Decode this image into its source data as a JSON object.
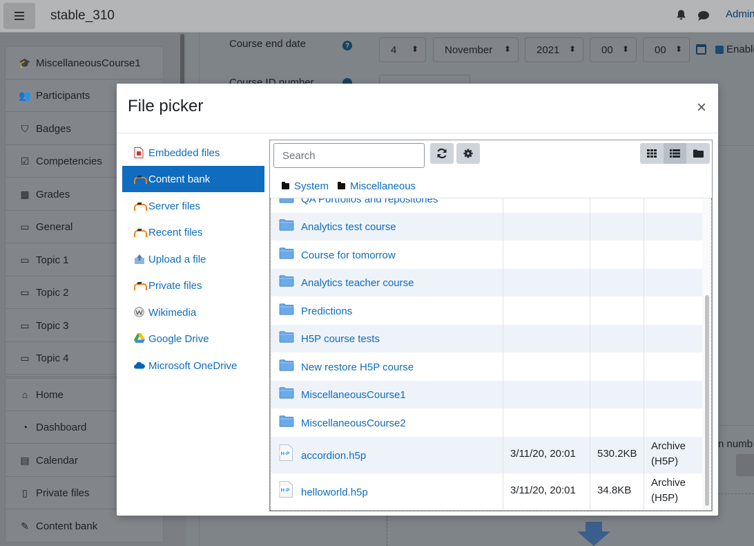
{
  "navbar": {
    "site_name": "stable_310",
    "user": "Admin"
  },
  "drawer": {
    "course_items": [
      {
        "label": "MiscellaneousCourse1",
        "icon": "graduation-cap-icon"
      },
      {
        "label": "Participants",
        "icon": "users-icon"
      },
      {
        "label": "Badges",
        "icon": "shield-icon"
      },
      {
        "label": "Competencies",
        "icon": "check-square-icon"
      },
      {
        "label": "Grades",
        "icon": "table-icon"
      },
      {
        "label": "General",
        "icon": "folder-icon"
      },
      {
        "label": "Topic 1",
        "icon": "folder-icon"
      },
      {
        "label": "Topic 2",
        "icon": "folder-icon"
      },
      {
        "label": "Topic 3",
        "icon": "folder-icon"
      },
      {
        "label": "Topic 4",
        "icon": "folder-icon"
      }
    ],
    "site_items": [
      {
        "label": "Home",
        "icon": "home-icon"
      },
      {
        "label": "Dashboard",
        "icon": "dashboard-icon"
      },
      {
        "label": "Calendar",
        "icon": "calendar-icon"
      },
      {
        "label": "Private files",
        "icon": "file-icon"
      },
      {
        "label": "Content bank",
        "icon": "paintbrush-icon"
      }
    ]
  },
  "form": {
    "course_end_date_label": "Course end date",
    "day": "4",
    "month": "November",
    "year": "2021",
    "hour": "00",
    "minute": "00",
    "enable_label": "Enable",
    "course_id_label": "Course ID number",
    "right_partial_label": "n numb"
  },
  "modal": {
    "title": "File picker",
    "close": "×",
    "repositories": [
      {
        "label": "Embedded files",
        "icon": "embedded-files-icon"
      },
      {
        "label": "Content bank",
        "icon": "moodle-icon",
        "active": true
      },
      {
        "label": "Server files",
        "icon": "moodle-icon"
      },
      {
        "label": "Recent files",
        "icon": "moodle-icon"
      },
      {
        "label": "Upload a file",
        "icon": "upload-icon"
      },
      {
        "label": "Private files",
        "icon": "moodle-icon"
      },
      {
        "label": "Wikimedia",
        "icon": "wikimedia-icon"
      },
      {
        "label": "Google Drive",
        "icon": "google-drive-icon"
      },
      {
        "label": "Microsoft OneDrive",
        "icon": "onedrive-icon"
      }
    ],
    "search_placeholder": "Search",
    "path": [
      "System",
      "Miscellaneous"
    ],
    "files": [
      {
        "name": "QA Portfolios and repositories",
        "type": "folder"
      },
      {
        "name": "Analytics test course",
        "type": "folder"
      },
      {
        "name": "Course for tomorrow",
        "type": "folder"
      },
      {
        "name": "Analytics teacher course",
        "type": "folder"
      },
      {
        "name": "Predictions",
        "type": "folder"
      },
      {
        "name": "H5P course tests",
        "type": "folder"
      },
      {
        "name": "New restore H5P course",
        "type": "folder"
      },
      {
        "name": "MiscellaneousCourse1",
        "type": "folder"
      },
      {
        "name": "MiscellaneousCourse2",
        "type": "folder"
      },
      {
        "name": "accordion.h5p",
        "type": "h5p",
        "date": "3/11/20, 20:01",
        "size": "530.2KB",
        "kind_line1": "Archive",
        "kind_line2": "(H5P)"
      },
      {
        "name": "helloworld.h5p",
        "type": "h5p",
        "date": "3/11/20, 20:01",
        "size": "34.8KB",
        "kind_line1": "Archive",
        "kind_line2": "(H5P)"
      }
    ]
  },
  "colors": {
    "link": "#0f6cbf",
    "active_bg": "#0f6cbf",
    "row_alt": "#eef3fa",
    "folder_blue": "#5aa0e6",
    "moodle_orange": "#f98012"
  }
}
